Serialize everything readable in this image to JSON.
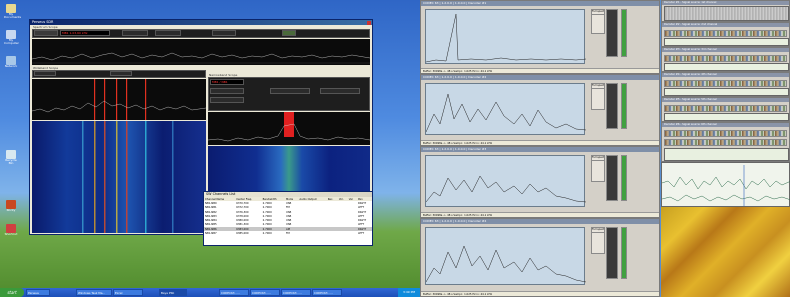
{
  "desktop": {
    "icons": [
      {
        "label": "My Documents",
        "color": "#e8d890"
      },
      {
        "label": "My Computer",
        "color": "#c8d8f0"
      },
      {
        "label": "Network",
        "color": "#a8c8e8"
      },
      {
        "label": "Recycle Bin",
        "color": "#d8e8f0"
      },
      {
        "label": "Rocky",
        "color": "#c84820"
      },
      {
        "label": "Shortcut",
        "color": "#d04040"
      }
    ]
  },
  "spectrum_window": {
    "title": "Perseus SDR",
    "scope_label": "Spectrum Scope",
    "freq_display": "MB1 1.03,60 kHz",
    "wideband_label": "Wideband Scope",
    "narrowband_label": "Narrowband Scope",
    "narrow_freq": "MB1 / NB1"
  },
  "channel_list": {
    "title": "SW Channels List",
    "columns": [
      "Channel Name",
      "Center Freq.",
      "Bandwidth",
      "Mode",
      "Audio Output",
      "Rec.",
      "Vol.",
      "Ver",
      "Pan"
    ],
    "rows": [
      [
        "NB1-NB0",
        "6370,700",
        "2.7000",
        "USB",
        "",
        "",
        "",
        "",
        "RIGHT"
      ],
      [
        "NB1-NB1",
        "6372,700",
        "2.7000",
        "FM",
        "",
        "",
        "",
        "",
        "LEFT"
      ],
      [
        "NB1-NB2",
        "6376,300",
        "2.7000",
        "USB",
        "",
        "",
        "",
        "",
        "RIGHT"
      ],
      [
        "NB1-NB3",
        "6378,000",
        "2.7000",
        "USB",
        "",
        "",
        "",
        "",
        "LEFT"
      ],
      [
        "NB1-NB4",
        "6380,000",
        "2.7000",
        "USB",
        "",
        "",
        "",
        "",
        "RIGHT"
      ],
      [
        "NB1-NB5",
        "6381,300",
        "2.7000",
        "USB",
        "",
        "",
        "",
        "",
        "LEFT"
      ],
      [
        "NB1-NB6",
        "6383,000",
        "2.7000",
        "AM",
        "",
        "",
        "",
        "",
        "RIGHT"
      ],
      [
        "NB1-NB7",
        "6385,000",
        "2.7000",
        "FM",
        "",
        "",
        "",
        "",
        "LEFT"
      ]
    ]
  },
  "taskbar": {
    "start": "start",
    "buttons": [
      "Perseus",
      "Windows Task Ma...",
      "Excel",
      "Baye PSK",
      "CODEC63 - ...",
      "CODEC63 - ...",
      "CODEC63 - ...",
      "CODEC63 - ..."
    ],
    "clock": "3:49 PM"
  },
  "codec_windows": [
    {
      "title": "CODEC 63 | 1.2.0.0 | 1.0.0.0 | Decoder #1",
      "status": "Buffer: 30498a <- 48 s  Sampl.: 1.025 Hz  in: 44.1 kHz"
    },
    {
      "title": "CODEC 63 | 1.2.0.0 | 1.0.0.0 | Decoder #2",
      "status": "Buffer: 30498a <- 48 s  Sampl.: 1.025 Hz  in: 44.1 kHz"
    },
    {
      "title": "CODEC 63 | 1.2.0.0 | 1.0.0.0 | Decoder #3",
      "status": "Buffer: 30498a <- 48 s  Sampl.: 1.025 Hz  in: 44.1 kHz"
    },
    {
      "title": "CODEC 63 | 1.2.0.0 | 1.0.0.0 | Decoder #4",
      "status": "Buffer: 30498a <- 48 s  Sampl.: 1.025 Hz  in: 44.1 kHz"
    }
  ],
  "codec_buttons": [
    "Full spectrum",
    "Peak",
    "Time",
    "Zoom",
    "Clear"
  ],
  "decoders": [
    "Decoder #1 - Signal source: 1st channel",
    "Decoder #2 - Signal source: 2nd channel",
    "Decoder #3 - Signal source: 3rd channel",
    "Decoder #4 - Signal source: 4th channel",
    "Decoder #5 - Signal source: 5th channel",
    "Decoder #6 - Signal source: 6th channel"
  ],
  "colors": {
    "accent": "#0a246a",
    "marker": "#e03020",
    "spectrum": "#ffffff"
  }
}
